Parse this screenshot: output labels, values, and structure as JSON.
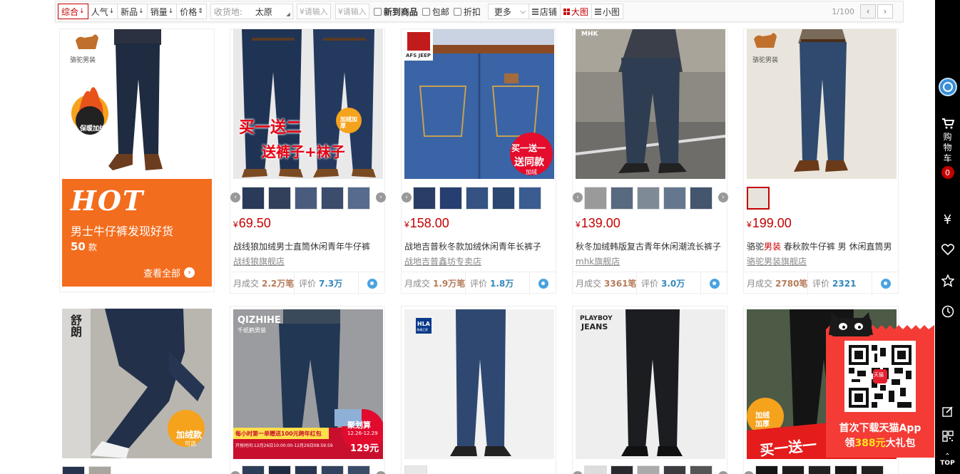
{
  "filter_bar": {
    "sort": [
      {
        "label": "综合",
        "active": true
      },
      {
        "label": "人气",
        "active": false
      },
      {
        "label": "新品",
        "active": false
      },
      {
        "label": "销量",
        "active": false
      },
      {
        "label": "价格",
        "active": false
      }
    ],
    "location_label": "收货地:",
    "location_value": "太原",
    "price_min_placeholder": "¥请输入",
    "price_max_placeholder": "¥请输入",
    "checks": [
      "新到商品",
      "包邮",
      "折扣"
    ],
    "more_label": "更多",
    "views": [
      {
        "label": "店铺",
        "active": false
      },
      {
        "label": "大图",
        "active": true
      },
      {
        "label": "小图",
        "active": false
      }
    ],
    "page_indicator": "1/100"
  },
  "hot_card": {
    "heading": "HOT",
    "title": "男士牛仔裤发现好货",
    "count": "50",
    "count_unit": "款",
    "view_all": "查看全部",
    "brand_tag": "骆驼男装",
    "badge": "保暖加绒"
  },
  "products": [
    {
      "price": "69.50",
      "title": "战线狼加绒男士直筒休闲青年牛仔裤",
      "shop": "战线狼旗舰店",
      "sales_label": "月成交",
      "sales": "2.2万笔",
      "reviews_label": "评价",
      "reviews": "7.3万",
      "overlay_line1": "买一送二",
      "overlay_line2": "送裤子+袜子",
      "overlay_badge": "加绒加厚"
    },
    {
      "price": "158.00",
      "title": "战地吉普秋冬款加绒休闲青年长裤子",
      "shop": "战地吉普鑫坊专卖店",
      "sales_label": "月成交",
      "sales": "1.9万笔",
      "reviews_label": "评价",
      "reviews": "1.8万",
      "brand": "AFS JEEP",
      "overlay_line1": "买一送一",
      "overlay_line2": "送同款",
      "overlay_line3": "加绒"
    },
    {
      "price": "139.00",
      "title": "秋冬加绒韩版复古青年休闲潮流长裤子",
      "shop": "mhk旗舰店",
      "sales_label": "月成交",
      "sales": "3361笔",
      "reviews_label": "评价",
      "reviews": "3.0万",
      "brand": "MHK"
    },
    {
      "price": "199.00",
      "title_pre": "骆驼",
      "title_hl": "男装",
      "title_post": " 春秋款牛仔裤 男 休闲直筒男",
      "shop": "骆驼男装旗舰店",
      "sales_label": "月成交",
      "sales": "2780笔",
      "reviews_label": "评价",
      "reviews": "2321",
      "brand_tag": "骆驼男装"
    }
  ],
  "row2": [
    {
      "brand": "舒朗",
      "badge": "加绒款",
      "badge_sub": "可选"
    },
    {
      "brand": "QIZHIHE",
      "brand_sub": "千纸鹤男装",
      "banner": "每小时第一单赠送100元跨年红包",
      "banner_sub": "开抢时间:12月26日10:00:00-12月29日08:59:59",
      "promo": "聚划算",
      "promo_date": "12.26-12.29",
      "promo_price": "129元"
    },
    {
      "brand": "HLA",
      "brand_sub": "海澜之家"
    },
    {
      "brand": "PLAYBOY",
      "brand_sub": "JEANS"
    },
    {
      "badge": "加绒加厚",
      "banner": "买一送一"
    }
  ],
  "sidebar": {
    "cart_label": "购物车",
    "cart_count": "0",
    "top_label": "TOP"
  },
  "app_popup": {
    "tag": "天猫",
    "line1": "首次下载天猫App",
    "line2_pre": "领",
    "line2_amount": "388元",
    "line2_post": "大礼包"
  },
  "currency": "¥"
}
